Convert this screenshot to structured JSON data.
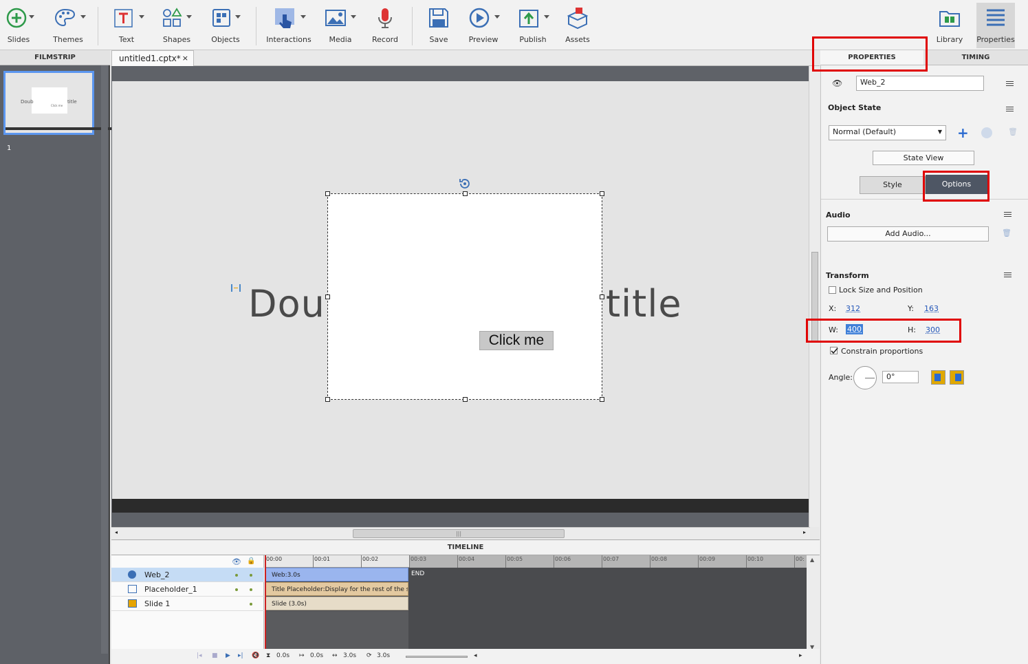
{
  "toolbar": {
    "items": [
      {
        "label": "Slides",
        "icon": "plus-circle-icon"
      },
      {
        "label": "Themes",
        "icon": "palette-icon"
      },
      {
        "label": "Text",
        "icon": "text-icon"
      },
      {
        "label": "Shapes",
        "icon": "shapes-icon"
      },
      {
        "label": "Objects",
        "icon": "objects-icon"
      },
      {
        "label": "Interactions",
        "icon": "hand-pointer-icon"
      },
      {
        "label": "Media",
        "icon": "image-icon"
      },
      {
        "label": "Record",
        "icon": "microphone-icon"
      },
      {
        "label": "Save",
        "icon": "floppy-icon"
      },
      {
        "label": "Preview",
        "icon": "play-icon"
      },
      {
        "label": "Publish",
        "icon": "publish-icon"
      },
      {
        "label": "Assets",
        "icon": "assets-icon"
      },
      {
        "label": "Library",
        "icon": "folder-icon"
      },
      {
        "label": "Properties",
        "icon": "properties-icon"
      }
    ]
  },
  "filmstrip": {
    "header": "FILMSTRIP",
    "slide_number": "1",
    "thumb_left": "Doub",
    "thumb_right": "title"
  },
  "document": {
    "tab_label": "untitled1.cptx*",
    "close": "×"
  },
  "stage": {
    "title_left": "Doub",
    "title_right": "title",
    "button_label": "Click me"
  },
  "timeline": {
    "title": "TIMELINE",
    "ticks": [
      "00:00",
      "00:01",
      "00:02",
      "00:03",
      "00:04",
      "00:05",
      "00:06",
      "00:07",
      "00:08",
      "00:09",
      "00:10",
      "00:"
    ],
    "layers": [
      {
        "name": "Web_2",
        "bar": "Web:3.0s"
      },
      {
        "name": "Placeholder_1",
        "bar": "Title Placeholder:Display for the rest of the s..."
      },
      {
        "name": "Slide 1",
        "bar": "Slide (3.0s)"
      }
    ],
    "end_label": "END",
    "controls": {
      "current": "0.0s",
      "start": "0.0s",
      "duration": "3.0s",
      "end": "3.0s"
    }
  },
  "properties": {
    "tab_properties": "PROPERTIES",
    "tab_timing": "TIMING",
    "object_name": "Web_2",
    "object_state_title": "Object State",
    "state_value": "Normal (Default)",
    "state_view_label": "State View",
    "subtab_style": "Style",
    "subtab_options": "Options",
    "audio_title": "Audio",
    "add_audio_label": "Add Audio...",
    "transform_title": "Transform",
    "lock_label": "Lock Size and Position",
    "x_label": "X:",
    "x_value": "312",
    "y_label": "Y:",
    "y_value": "163",
    "w_label": "W:",
    "w_value": "400",
    "h_label": "H:",
    "h_value": "300",
    "constrain_label": "Constrain proportions",
    "angle_label": "Angle:",
    "angle_value": "0°"
  },
  "colors": {
    "accent": "#5b96f0",
    "highlight": "#e00000"
  }
}
